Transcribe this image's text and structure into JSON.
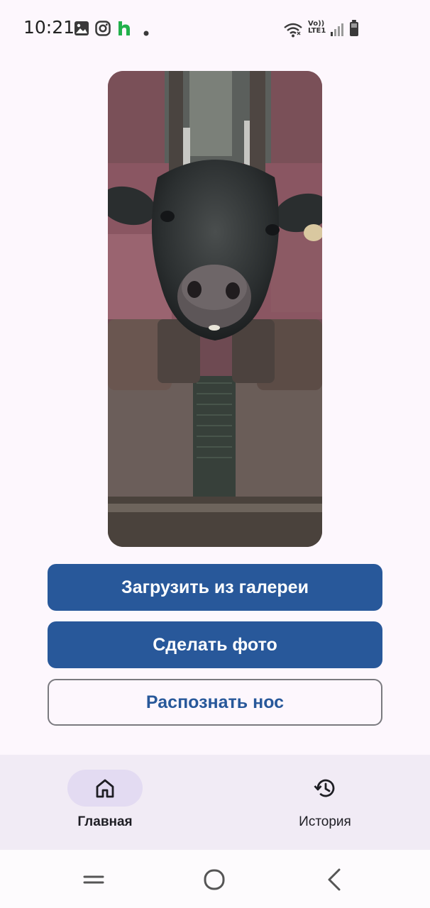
{
  "status_bar": {
    "time": "10:21",
    "network_label_top": "Vo))",
    "network_label_bottom": "LTE1",
    "icons": [
      "gallery-icon",
      "instagram-icon",
      "hh-app-icon",
      "notification-dot",
      "wifi-icon",
      "signal-icon",
      "battery-icon"
    ]
  },
  "main": {
    "photo_description_icon": "cow-photo",
    "buttons": {
      "upload": "Загрузить из галереи",
      "take_photo": "Сделать фото",
      "recognize": "Распознать нос"
    }
  },
  "bottom_nav": {
    "items": [
      {
        "label": "Главная",
        "icon": "home-icon",
        "active": true
      },
      {
        "label": "История",
        "icon": "history-icon",
        "active": false
      }
    ]
  },
  "colors": {
    "primary": "#28589a",
    "background": "#fdf7fd",
    "nav_background": "#f1ebf5",
    "active_pill": "#e3dbf2"
  },
  "system_nav": {
    "icons": [
      "recent-apps-icon",
      "home-circle-icon",
      "back-icon"
    ]
  }
}
